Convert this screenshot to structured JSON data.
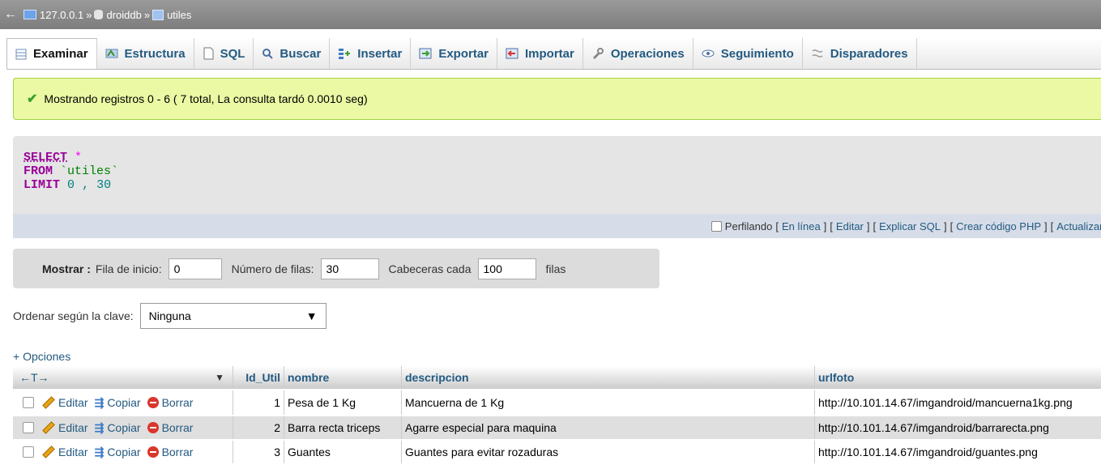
{
  "breadcrumb": {
    "back": "←",
    "server": "127.0.0.1",
    "database": "droiddb",
    "table": "utiles",
    "separator": "»"
  },
  "tabs": [
    {
      "label": "Examinar",
      "icon": "browse-icon"
    },
    {
      "label": "Estructura",
      "icon": "structure-icon"
    },
    {
      "label": "SQL",
      "icon": "sql-icon"
    },
    {
      "label": "Buscar",
      "icon": "search-icon"
    },
    {
      "label": "Insertar",
      "icon": "insert-icon"
    },
    {
      "label": "Exportar",
      "icon": "export-icon"
    },
    {
      "label": "Importar",
      "icon": "import-icon"
    },
    {
      "label": "Operaciones",
      "icon": "operations-icon"
    },
    {
      "label": "Seguimiento",
      "icon": "tracking-icon"
    },
    {
      "label": "Disparadores",
      "icon": "triggers-icon"
    }
  ],
  "notice": {
    "text": "Mostrando registros 0 - 6 ( 7 total, La consulta tardó 0.0010 seg)"
  },
  "query": {
    "select": "SELECT",
    "star": "*",
    "from": "FROM",
    "table": "`utiles`",
    "limit": "LIMIT",
    "limit_start": "0",
    "comma": ",",
    "limit_count": "30"
  },
  "query_actions": {
    "profiling": "Perfilando",
    "links": [
      "En línea",
      "Editar",
      "Explicar SQL",
      "Crear código PHP",
      "Actualizar"
    ]
  },
  "navigation": {
    "show_label": "Mostrar :",
    "start_label": "Fila de inicio:",
    "start_value": "0",
    "rows_label": "Número de filas:",
    "rows_value": "30",
    "headers_label": "Cabeceras cada",
    "headers_value": "100",
    "rows_suffix": "filas"
  },
  "sort": {
    "label": "Ordenar según la clave:",
    "selected": "Ninguna"
  },
  "options_link": "+ Opciones",
  "table": {
    "arrows": "←T→",
    "columns": [
      "Id_Util",
      "nombre",
      "descripcion",
      "urlfoto"
    ],
    "actions": {
      "edit": "Editar",
      "copy": "Copiar",
      "delete": "Borrar"
    },
    "rows": [
      {
        "id": "1",
        "nombre": "Pesa de 1 Kg",
        "descripcion": "Mancuerna de 1 Kg",
        "urlfoto": "http://10.101.14.67/imgandroid/mancuerna1kg.png"
      },
      {
        "id": "2",
        "nombre": "Barra recta triceps",
        "descripcion": "Agarre especial para maquina",
        "urlfoto": "http://10.101.14.67/imgandroid/barrarecta.png"
      },
      {
        "id": "3",
        "nombre": "Guantes",
        "descripcion": "Guantes para evitar rozaduras",
        "urlfoto": "http://10.101.14.67/imgandroid/guantes.png"
      }
    ]
  },
  "colors": {
    "link": "#235a81",
    "notice_bg": "#ebf8a4",
    "keyword": "#990099"
  }
}
